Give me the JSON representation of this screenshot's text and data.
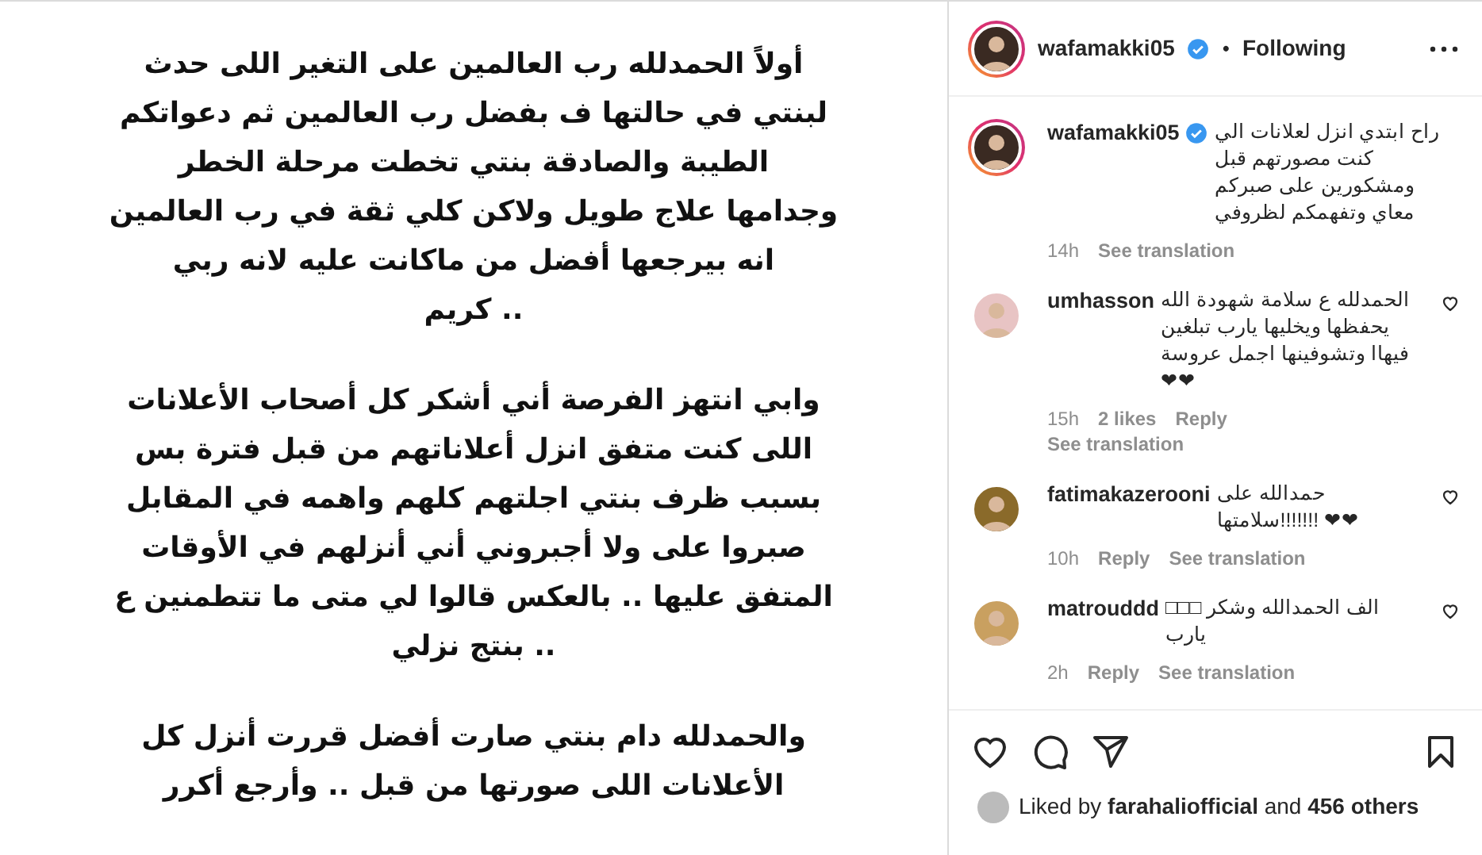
{
  "post_image": {
    "paragraphs": [
      [
        "أولاً الحمدلله رب العالمين على التغير اللى حدث",
        "لبنتي في حالتها ف بفضل رب العالمين ثم دعواتكم",
        "الطيبة والصادقة بنتي تخطت مرحلة الخطر",
        "وجدامها علاج طويل ولاكن كلي ثقة في رب العالمين",
        "انه بيرجعها أفضل من ماكانت عليه لانه ربي",
        "كريم .."
      ],
      [
        "وابي انتهز الفرصة أني أشكر كل أصحاب الأعلانات",
        "اللى كنت متفق انزل أعلاناتهم من قبل فترة بس",
        "بسبب ظرف بنتي اجلتهم كلهم واهمه في المقابل",
        "صبروا على ولا أجبروني أني أنزلهم في الأوقات",
        "المتفق عليها .. بالعكس قالوا لي متى ما تتطمنين ع",
        "بنتج نزلي .."
      ],
      [
        "والحمدلله دام بنتي صارت أفضل قررت أنزل كل",
        "الأعلانات اللى صورتها من قبل .. وأرجع أكرر"
      ]
    ]
  },
  "header": {
    "username": "wafamakki05",
    "verified": true,
    "separator": "•",
    "follow_label": "Following",
    "story_ring": true
  },
  "caption": {
    "username": "wafamakki05",
    "verified": true,
    "story_ring": true,
    "text": "راح ابتدي انزل لعلانات الي كنت مصورتهم قبل ومشكورين على صبركم معاي وتفهمكم لظروفي",
    "time": "14h",
    "translate": "See translation"
  },
  "comments": [
    {
      "username": "umhasson",
      "text": "الحمدلله ع سلامة شهودة الله يحفظها ويخليها يارب تبلغين فيهاا وتشوفينها اجمل عروسة ❤❤",
      "time": "15h",
      "likes": "2 likes",
      "reply": "Reply",
      "translate": "See translation",
      "color": "#e8c4c4"
    },
    {
      "username": "fatimakazerooni",
      "text": "حمدالله على سلامتها!!!!!!! ❤❤",
      "time": "10h",
      "reply": "Reply",
      "translate": "See translation",
      "color": "#8a6a2a"
    },
    {
      "username": "matrouddd",
      "text": "□□□ الف الحمدالله وشكر يارب",
      "time": "2h",
      "reply": "Reply",
      "translate": "See translation",
      "color": "#c9a060"
    }
  ],
  "actions": {
    "liked": false,
    "saved": false
  },
  "likes": {
    "prefix": "Liked by",
    "user": "farahaliofficial",
    "middle": "and",
    "count": "456 others"
  }
}
